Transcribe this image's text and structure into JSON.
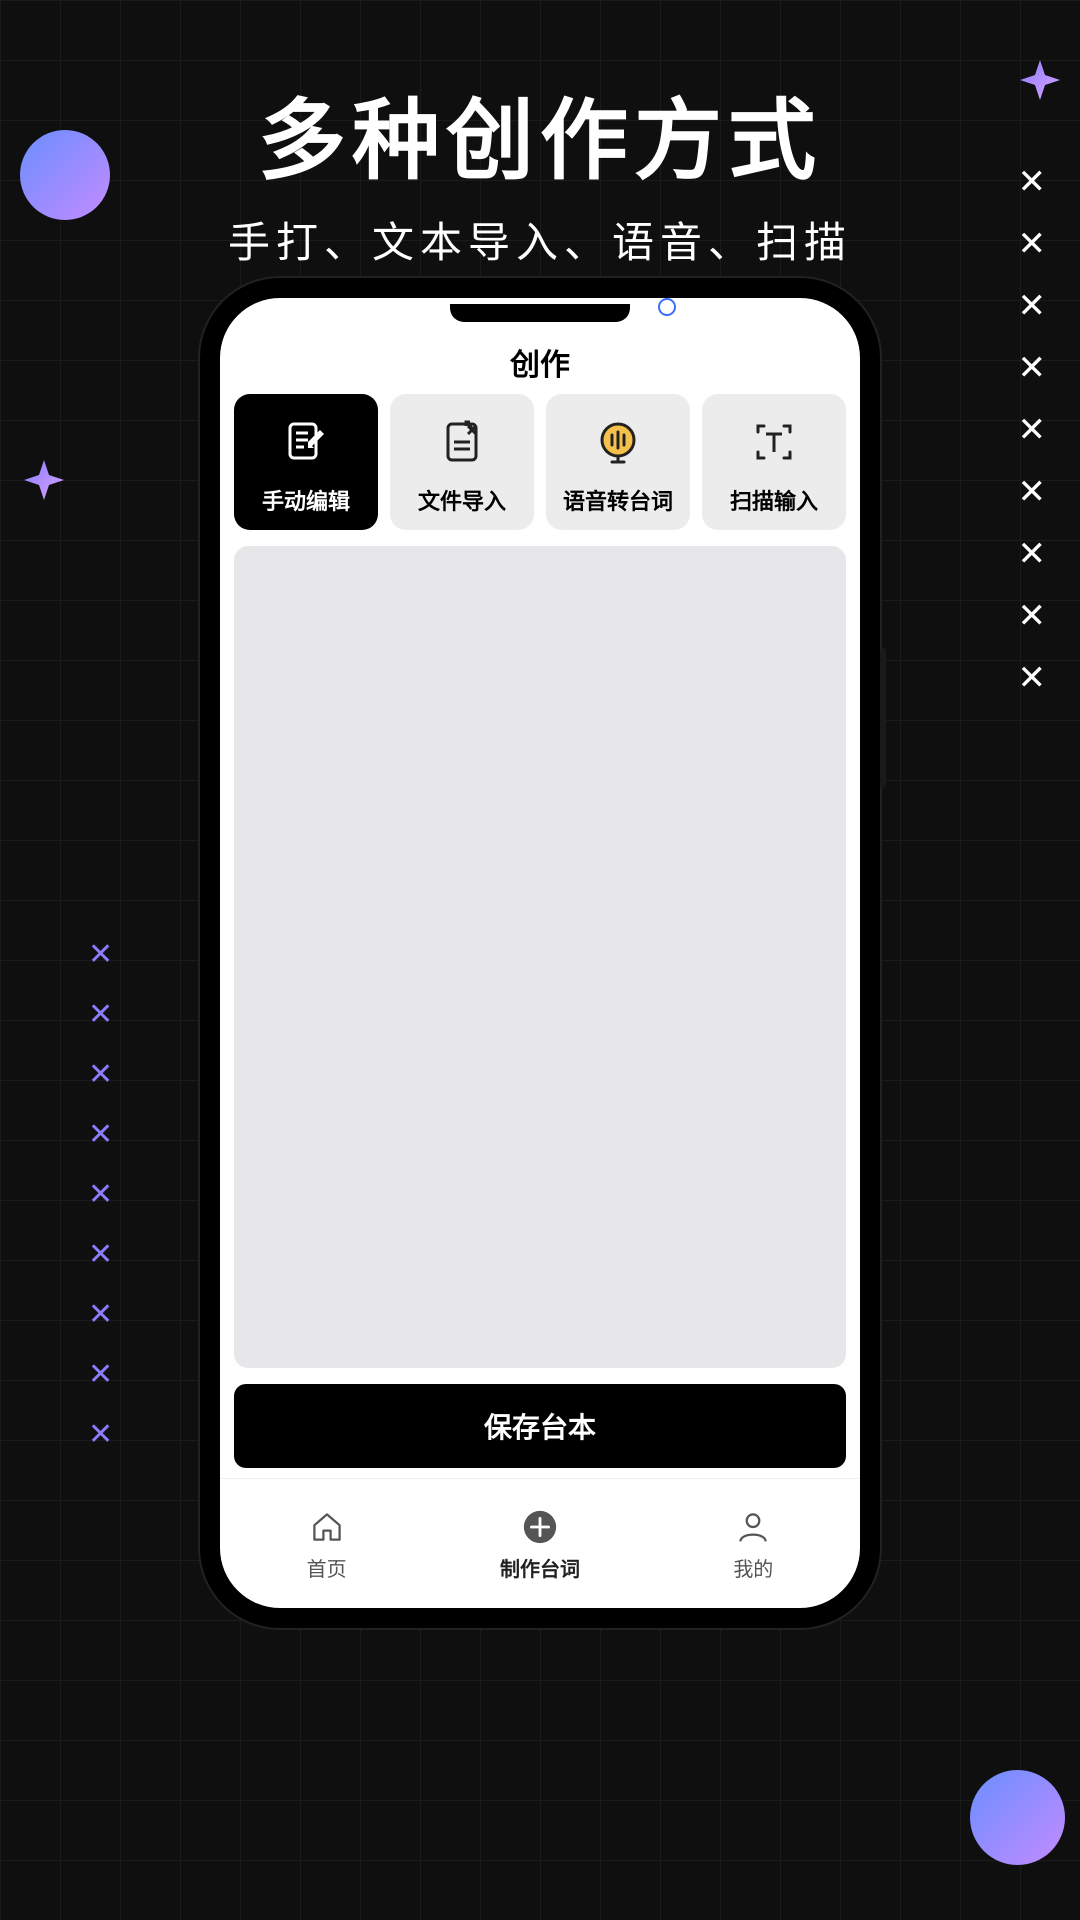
{
  "headline": {
    "title": "多种创作方式",
    "subtitle": "手打、文本导入、语音、扫描"
  },
  "app": {
    "title": "创作",
    "tabs": [
      {
        "label": "手动编辑",
        "icon": "edit-doc-icon",
        "active": true
      },
      {
        "label": "文件导入",
        "icon": "file-import-icon",
        "active": false
      },
      {
        "label": "语音转台词",
        "icon": "voice-icon",
        "active": false
      },
      {
        "label": "扫描输入",
        "icon": "scan-text-icon",
        "active": false
      }
    ],
    "save_button": "保存台本",
    "bottom_nav": [
      {
        "label": "首页",
        "icon": "home-icon",
        "active": false
      },
      {
        "label": "制作台词",
        "icon": "add-circle-icon",
        "active": true
      },
      {
        "label": "我的",
        "icon": "profile-icon",
        "active": false
      }
    ]
  },
  "decor": {
    "x_right_count": 9,
    "x_left_count": 9
  }
}
